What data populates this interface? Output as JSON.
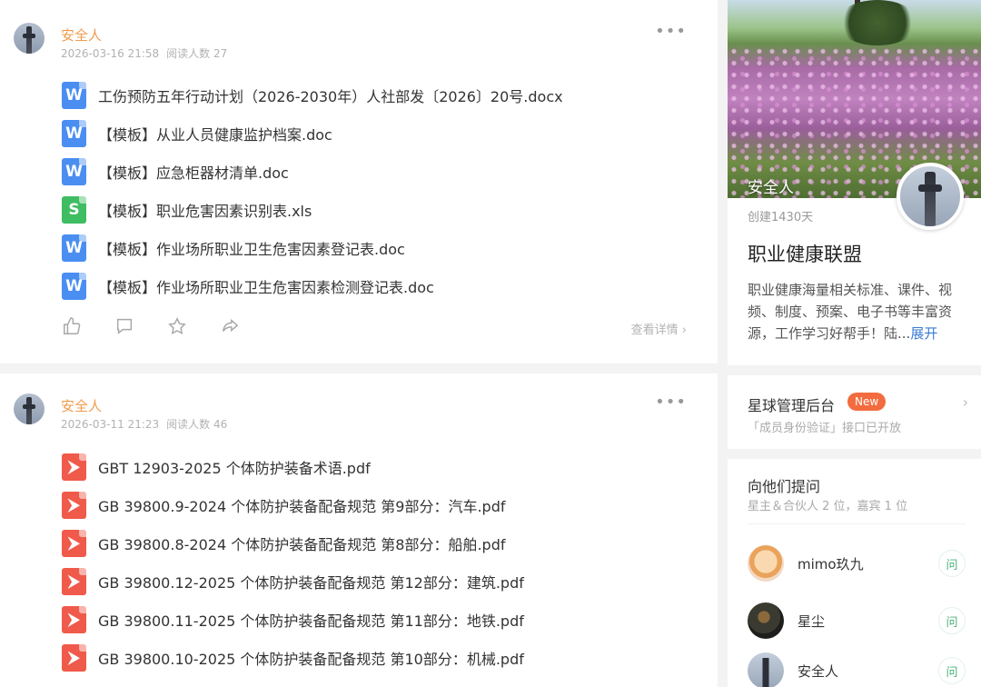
{
  "posts": [
    {
      "author": "安全人",
      "date": "2026-03-16 21:58",
      "readers": "阅读人数 27",
      "more_icon": "more-dots-icon",
      "files": [
        {
          "type": "doc",
          "icon": "word-file-icon",
          "name": "工伤预防五年行动计划（2026-2030年）人社部发〔2026〕20号.docx"
        },
        {
          "type": "doc",
          "icon": "word-file-icon",
          "name": "【模板】从业人员健康监护档案.doc"
        },
        {
          "type": "doc",
          "icon": "word-file-icon",
          "name": "【模板】应急柜器材清单.doc"
        },
        {
          "type": "xls",
          "icon": "excel-file-icon",
          "name": "【模板】职业危害因素识别表.xls"
        },
        {
          "type": "doc",
          "icon": "word-file-icon",
          "name": "【模板】作业场所职业卫生危害因素登记表.doc"
        },
        {
          "type": "doc",
          "icon": "word-file-icon",
          "name": "【模板】作业场所职业卫生危害因素检测登记表.doc"
        }
      ],
      "actions": [
        "like-icon",
        "comment-icon",
        "star-icon",
        "share-icon"
      ],
      "detail_link": "查看详情"
    },
    {
      "author": "安全人",
      "date": "2026-03-11 21:23",
      "readers": "阅读人数 46",
      "more_icon": "more-dots-icon",
      "files": [
        {
          "type": "pdf",
          "icon": "pdf-file-icon",
          "name": "GBT 12903-2025 个体防护装备术语.pdf"
        },
        {
          "type": "pdf",
          "icon": "pdf-file-icon",
          "name": "GB 39800.9-2024 个体防护装备配备规范 第9部分：汽车.pdf"
        },
        {
          "type": "pdf",
          "icon": "pdf-file-icon",
          "name": "GB 39800.8-2024 个体防护装备配备规范 第8部分：船舶.pdf"
        },
        {
          "type": "pdf",
          "icon": "pdf-file-icon",
          "name": "GB 39800.12-2025 个体防护装备配备规范 第12部分：建筑.pdf"
        },
        {
          "type": "pdf",
          "icon": "pdf-file-icon",
          "name": "GB 39800.11-2025 个体防护装备配备规范 第11部分：地铁.pdf"
        },
        {
          "type": "pdf",
          "icon": "pdf-file-icon",
          "name": "GB 39800.10-2025 个体防护装备配备规范 第10部分：机械.pdf"
        }
      ]
    }
  ],
  "sidebar": {
    "cover_name": "安全人",
    "created": "创建1430天",
    "group_title": "职业健康联盟",
    "group_desc": "职业健康海量相关标准、课件、视频、制度、预案、电子书等丰富资源，工作学习好帮手！陆...",
    "expand_label": "展开",
    "admin": {
      "title": "星球管理后台",
      "badge": "New",
      "subtitle": "「成员身份验证」接口已开放"
    },
    "ask": {
      "title": "向他们提问",
      "subtitle": "星主＆合伙人 2 位，嘉宾 1 位",
      "button_label": "问",
      "members": [
        {
          "name": "mimo玖九"
        },
        {
          "name": "星尘"
        },
        {
          "name": "安全人"
        }
      ]
    }
  },
  "colors": {
    "author": "#f29b4c",
    "word": "#4a8ef2",
    "excel": "#3fbd62",
    "pdf": "#f05a4a",
    "badge": "#f26c3f",
    "expand": "#3a7bd5",
    "ask_button": "#4bb07a"
  }
}
